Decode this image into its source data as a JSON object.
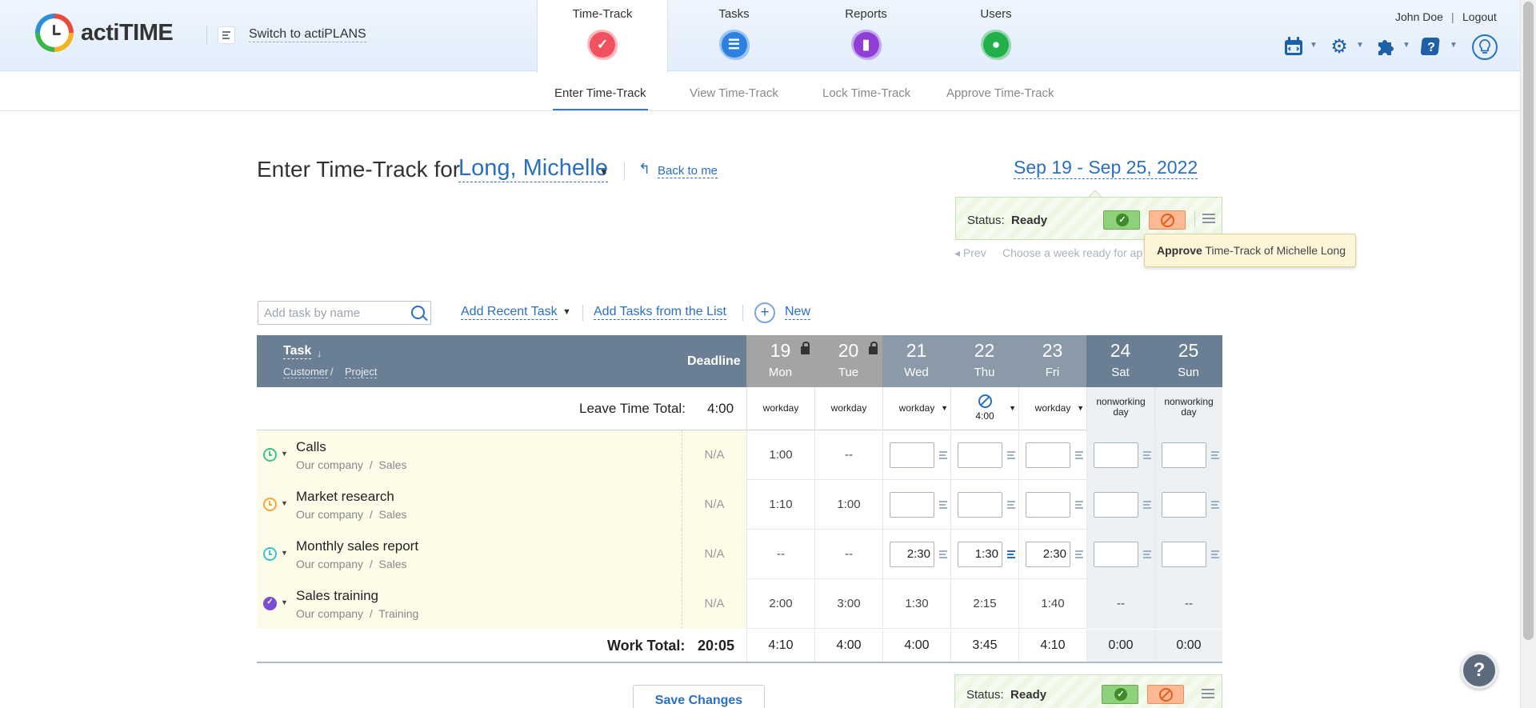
{
  "app": {
    "logo_text": "actiTIME",
    "switch_label": "Switch to actiPLANS"
  },
  "main_tabs": [
    {
      "label": "Time-Track",
      "icon": "checkmark-icon",
      "color": "#f0525f",
      "active": true
    },
    {
      "label": "Tasks",
      "icon": "list-icon",
      "color": "#2d7fe0",
      "active": false
    },
    {
      "label": "Reports",
      "icon": "bar-chart-icon",
      "color": "#8f3fd6",
      "active": false
    },
    {
      "label": "Users",
      "icon": "user-icon",
      "color": "#22b04b",
      "active": false
    }
  ],
  "user_menu": {
    "name": "John Doe",
    "separator": "|",
    "logout": "Logout"
  },
  "top_icons": [
    "calendar-icon",
    "gear-icon",
    "puzzle-icon",
    "help-icon",
    "lightbulb-icon"
  ],
  "sub_tabs": [
    {
      "label": "Enter Time-Track",
      "active": true
    },
    {
      "label": "View Time-Track",
      "active": false
    },
    {
      "label": "Lock Time-Track",
      "active": false
    },
    {
      "label": "Approve Time-Track",
      "active": false
    }
  ],
  "heading": {
    "title": "Enter Time-Track for",
    "user": "Long, Michelle",
    "back_link": "Back to me",
    "week": "Sep 19 - Sep 25, 2022"
  },
  "status": {
    "label": "Status:",
    "value": "Ready",
    "prev": "Prev",
    "hint": "Choose a week ready for approval",
    "tooltip_bold": "Approve",
    "tooltip_rest": " Time-Track of Michelle Long"
  },
  "toolbar": {
    "search_placeholder": "Add task by name",
    "add_recent": "Add Recent Task",
    "add_from_list": "Add Tasks from the List",
    "new_label": "New"
  },
  "table": {
    "task_header": "Task",
    "sort_arrow": "↓",
    "customer_header": "Customer",
    "slash": "/",
    "project_header": "Project",
    "deadline_header": "Deadline",
    "days": [
      {
        "num": "19",
        "wd": "Mon",
        "locked": true,
        "color": "#a4a4a4"
      },
      {
        "num": "20",
        "wd": "Tue",
        "locked": true,
        "color": "#a4a4a4"
      },
      {
        "num": "21",
        "wd": "Wed",
        "locked": false,
        "color": "#8a9aa9"
      },
      {
        "num": "22",
        "wd": "Thu",
        "locked": false,
        "color": "#8a9aa9"
      },
      {
        "num": "23",
        "wd": "Fri",
        "locked": false,
        "color": "#8a9aa9"
      },
      {
        "num": "24",
        "wd": "Sat",
        "locked": false,
        "color": "#6a7f93"
      },
      {
        "num": "25",
        "wd": "Sun",
        "locked": false,
        "color": "#6a7f93"
      }
    ],
    "leave": {
      "label": "Leave Time Total:",
      "total": "4:00",
      "cells": [
        {
          "text": "workday",
          "dropdown": false
        },
        {
          "text": "workday",
          "dropdown": false
        },
        {
          "text": "workday",
          "dropdown": true
        },
        {
          "text": "4:00",
          "dropdown": true,
          "icon": "no-entry-icon"
        },
        {
          "text": "workday",
          "dropdown": true
        },
        {
          "text": "nonworking day",
          "dropdown": false
        },
        {
          "text": "nonworking day",
          "dropdown": false
        }
      ]
    },
    "rows": [
      {
        "name": "Calls",
        "customer": "Our company",
        "project": "Sales",
        "deadline": "N/A",
        "icon_color": "#3cc48d",
        "cells": [
          {
            "v": "1:00"
          },
          {
            "v": "--"
          },
          {
            "input": ""
          },
          {
            "input": ""
          },
          {
            "input": ""
          },
          {
            "input": ""
          },
          {
            "input": ""
          }
        ]
      },
      {
        "name": "Market research",
        "customer": "Our company",
        "project": "Sales",
        "deadline": "N/A",
        "icon_color": "#f0a83a",
        "cells": [
          {
            "v": "1:10"
          },
          {
            "v": "1:00"
          },
          {
            "input": ""
          },
          {
            "input": ""
          },
          {
            "input": ""
          },
          {
            "input": ""
          },
          {
            "input": ""
          }
        ]
      },
      {
        "name": "Monthly sales report",
        "customer": "Our company",
        "project": "Sales",
        "deadline": "N/A",
        "icon_color": "#3bc2d8",
        "cells": [
          {
            "v": "--"
          },
          {
            "v": "--"
          },
          {
            "input": "2:30"
          },
          {
            "input": "1:30",
            "comment": true
          },
          {
            "input": "2:30"
          },
          {
            "input": ""
          },
          {
            "input": ""
          }
        ]
      },
      {
        "name": "Sales training",
        "customer": "Our company",
        "project": "Training",
        "deadline": "N/A",
        "icon_color": "#7a4fcf",
        "done": true,
        "cells": [
          {
            "v": "2:00"
          },
          {
            "v": "3:00"
          },
          {
            "v": "1:30"
          },
          {
            "v": "2:15"
          },
          {
            "v": "1:40"
          },
          {
            "v": "--"
          },
          {
            "v": "--"
          }
        ]
      }
    ],
    "work": {
      "label": "Work Total:",
      "total": "20:05",
      "cells": [
        "4:10",
        "4:00",
        "4:00",
        "3:45",
        "4:10",
        "0:00",
        "0:00"
      ]
    }
  },
  "save_label": "Save Changes",
  "help_label": "?"
}
